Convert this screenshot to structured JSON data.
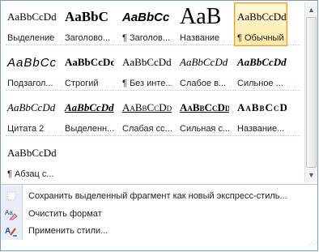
{
  "styles": [
    {
      "preview": "AaBbCcDd",
      "label": "Выделение",
      "cls": "p-nospace",
      "selected": false
    },
    {
      "preview": "AaBbC",
      "label": "Заголово...",
      "cls": "p-h1",
      "selected": false
    },
    {
      "preview": "AaBbCc",
      "label": "¶ Заголов...",
      "cls": "p-h2",
      "selected": false
    },
    {
      "preview": "AaB",
      "label": "Название",
      "cls": "p-title",
      "selected": false
    },
    {
      "preview": "AaBbCcDd",
      "label": "¶ Обычный",
      "cls": "p-titlesel",
      "selected": true
    },
    {
      "preview": "AaBbCc.",
      "label": "Подзагол...",
      "cls": "p-subtitle",
      "selected": false
    },
    {
      "preview": "AaBbCcDd",
      "label": "Строгий",
      "cls": "p-strong",
      "selected": false
    },
    {
      "preview": "AaBbCcDd",
      "label": "¶ Без инте...",
      "cls": "p-nointerv",
      "selected": false
    },
    {
      "preview": "AaBbCcDd",
      "label": "Слабое в...",
      "cls": "p-weak",
      "selected": false
    },
    {
      "preview": "AaBbCcDd",
      "label": "Сильное ...",
      "cls": "p-strongem",
      "selected": false
    },
    {
      "preview": "AaBbCcDd",
      "label": "Цитата 2",
      "cls": "p-quote",
      "selected": false
    },
    {
      "preview": "AaBbCcDd",
      "label": "Выделенн...",
      "cls": "p-intquote",
      "selected": false
    },
    {
      "preview": "AaBbCcDd",
      "label": "Слабая сс...",
      "cls": "p-weakref",
      "selected": false
    },
    {
      "preview": "AaBbCcDd",
      "label": "Сильная с...",
      "cls": "p-strongref",
      "selected": false
    },
    {
      "preview": "AaBbCcDd",
      "label": "Название...",
      "cls": "p-booktitle",
      "selected": false
    },
    {
      "preview": "AaBbCcDd",
      "label": "¶ Абзац с...",
      "cls": "p-listpar",
      "selected": false
    }
  ],
  "menu": {
    "save_label": "Сохранить выделенный фрагмент как новый экспресс-стиль...",
    "clear_label": "Очистить формат",
    "apply_label": "Применить стили..."
  },
  "scrollbar": {
    "up_icon": "scroll-up-arrow-icon",
    "down_icon": "scroll-down-arrow-icon"
  },
  "colors": {
    "selected_border": "#f0a030",
    "selected_fill": "#ffe9a8",
    "gutter": "#e9eef6"
  }
}
